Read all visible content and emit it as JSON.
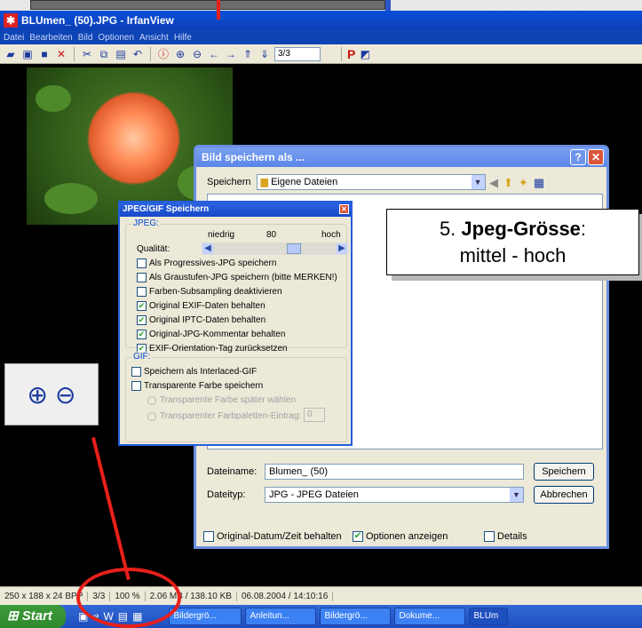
{
  "window": {
    "title": "BLUmen_ (50).JPG - IrfanView"
  },
  "menu": [
    "Datei",
    "Bearbeiten",
    "Bild",
    "Optionen",
    "Ansicht",
    "Hilfe"
  ],
  "toolbar": {
    "page_counter": "3/3"
  },
  "save_dialog": {
    "title": "Bild speichern als ...",
    "save_in_label": "Speichern",
    "save_in_value": "Eigene Dateien",
    "filename_label": "Dateiname:",
    "filename_value": "Blumen_ (50)",
    "filetype_label": "Dateityp:",
    "filetype_value": "JPG - JPEG Dateien",
    "save_button": "Speichern",
    "cancel_button": "Abbrechen",
    "options": [
      {
        "label": "Original-Datum/Zeit behalten",
        "checked": false
      },
      {
        "label": "Optionen anzeigen",
        "checked": true
      },
      {
        "label": "Details",
        "checked": false
      }
    ]
  },
  "jpeg_dialog": {
    "title": "JPEG/GIF Speichern",
    "jpeg_group": "JPEG:",
    "low_label": "niedrig",
    "quality_value": "80",
    "high_label": "hoch",
    "quality_label": "Qualität:",
    "quality_level": 80,
    "jpeg_options": [
      {
        "label": "Als Progressives-JPG speichern",
        "checked": false
      },
      {
        "label": "Als Graustufen-JPG speichern (bitte MERKEN!)",
        "checked": false
      },
      {
        "label": "Farben-Subsampling deaktivieren",
        "checked": false
      },
      {
        "label": "Original EXIF-Daten behalten",
        "checked": true
      },
      {
        "label": "Original IPTC-Daten behalten",
        "checked": true
      },
      {
        "label": "Original-JPG-Kommentar behalten",
        "checked": true
      },
      {
        "label": "EXIF-Orientation-Tag zurücksetzen",
        "checked": true
      }
    ],
    "gif_group": "GIF:",
    "gif_options": [
      {
        "label": "Speichern als Interlaced-GIF",
        "checked": false
      },
      {
        "label": "Transparente Farbe speichern",
        "checked": false
      }
    ],
    "radio_later": "Transparente Farbe später wählen",
    "radio_palette": "Transparenter Farbpaletten-Eintrag:",
    "palette_value": "0"
  },
  "callout": {
    "number": "5.",
    "bold": "Jpeg-Grösse",
    "colon": ":",
    "line2": "mittel - hoch"
  },
  "status": [
    "250 x 188 x 24 BPP",
    "3/3",
    "100 %",
    "2.06 MB / 138.10 KB",
    "06.08.2004 / 14:10:16"
  ],
  "taskbar": {
    "start": "Start",
    "tasks": [
      "Bildergrö...",
      "Anleitun...",
      "Bildergrö...",
      "Dokume...",
      "BLUm"
    ]
  },
  "colors": {
    "annotation": "#e8201a",
    "xp_blue": "#0a4fd8"
  }
}
